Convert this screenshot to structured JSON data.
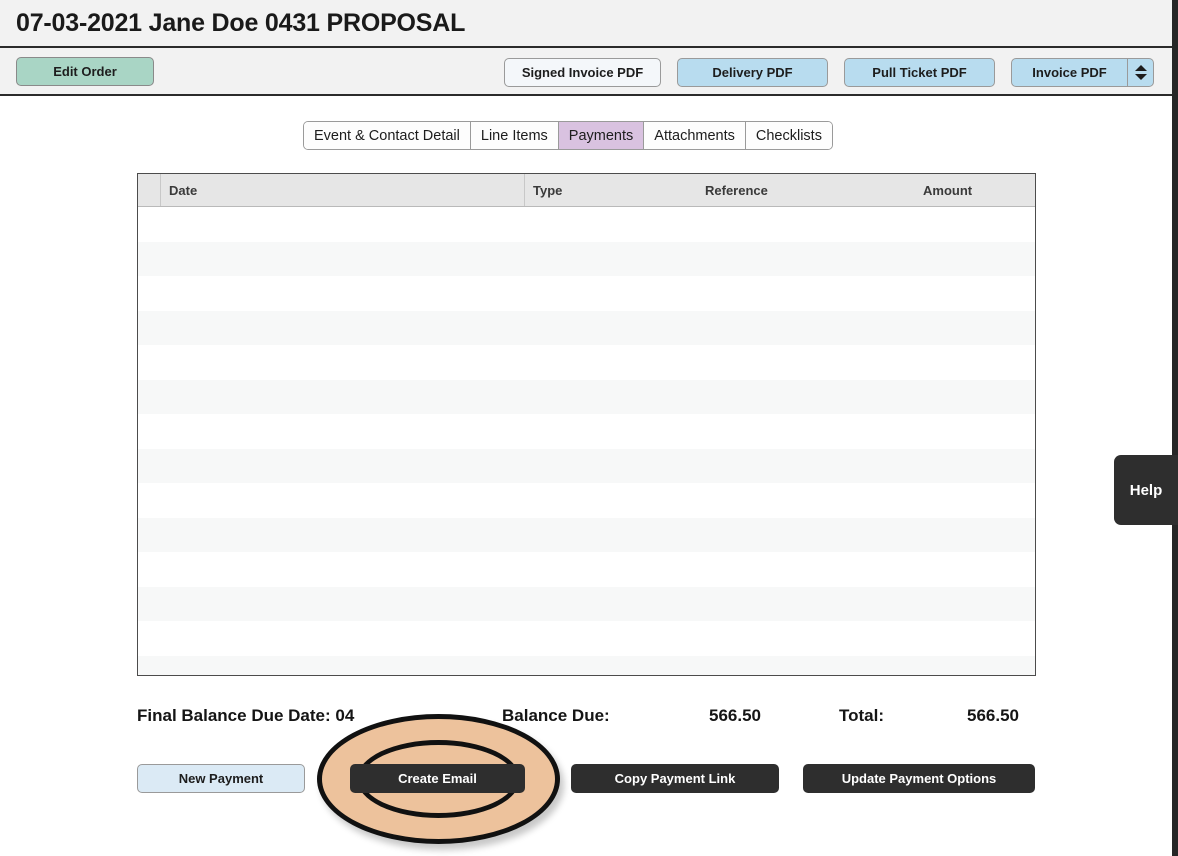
{
  "header": {
    "title": "07-03-2021 Jane Doe 0431 PROPOSAL"
  },
  "toolbar": {
    "edit_order_label": "Edit Order",
    "signed_invoice_pdf_label": "Signed Invoice PDF",
    "delivery_pdf_label": "Delivery PDF",
    "pull_ticket_pdf_label": "Pull Ticket PDF",
    "invoice_pdf_label": "Invoice PDF",
    "stepper_icon": "stepper-updown-icon"
  },
  "tabs": [
    {
      "label": "Event & Contact Detail",
      "active": false
    },
    {
      "label": "Line Items",
      "active": false
    },
    {
      "label": "Payments",
      "active": true
    },
    {
      "label": "Attachments",
      "active": false
    },
    {
      "label": "Checklists",
      "active": false
    }
  ],
  "payments_table": {
    "columns": [
      "",
      "Date",
      "Type",
      "Reference",
      "Amount"
    ],
    "rows": []
  },
  "summary": {
    "final_balance_due_date_label": "Final Balance Due Date: 04",
    "balance_due_label": "Balance Due:",
    "balance_due_value": "566.50",
    "total_label": "Total:",
    "total_value": "566.50"
  },
  "actions": {
    "new_payment_label": "New Payment",
    "create_email_label": "Create Email",
    "copy_payment_link_label": "Copy Payment Link",
    "update_payment_options_label": "Update Payment Options"
  },
  "help": {
    "label": "Help"
  },
  "annotation": {
    "type": "highlight-oval",
    "targets": "Create Email",
    "fill_color": "#edc29c",
    "stroke_color": "#111111"
  },
  "colors": {
    "edit_order_bg": "#a9d5c5",
    "pdf_button_bg": "#b8dcef",
    "active_tab_bg": "#d9c2e0",
    "dark_button_bg": "#2e2e2e",
    "new_payment_bg": "#dbeaf5",
    "header_bg": "#f2f2f2"
  }
}
